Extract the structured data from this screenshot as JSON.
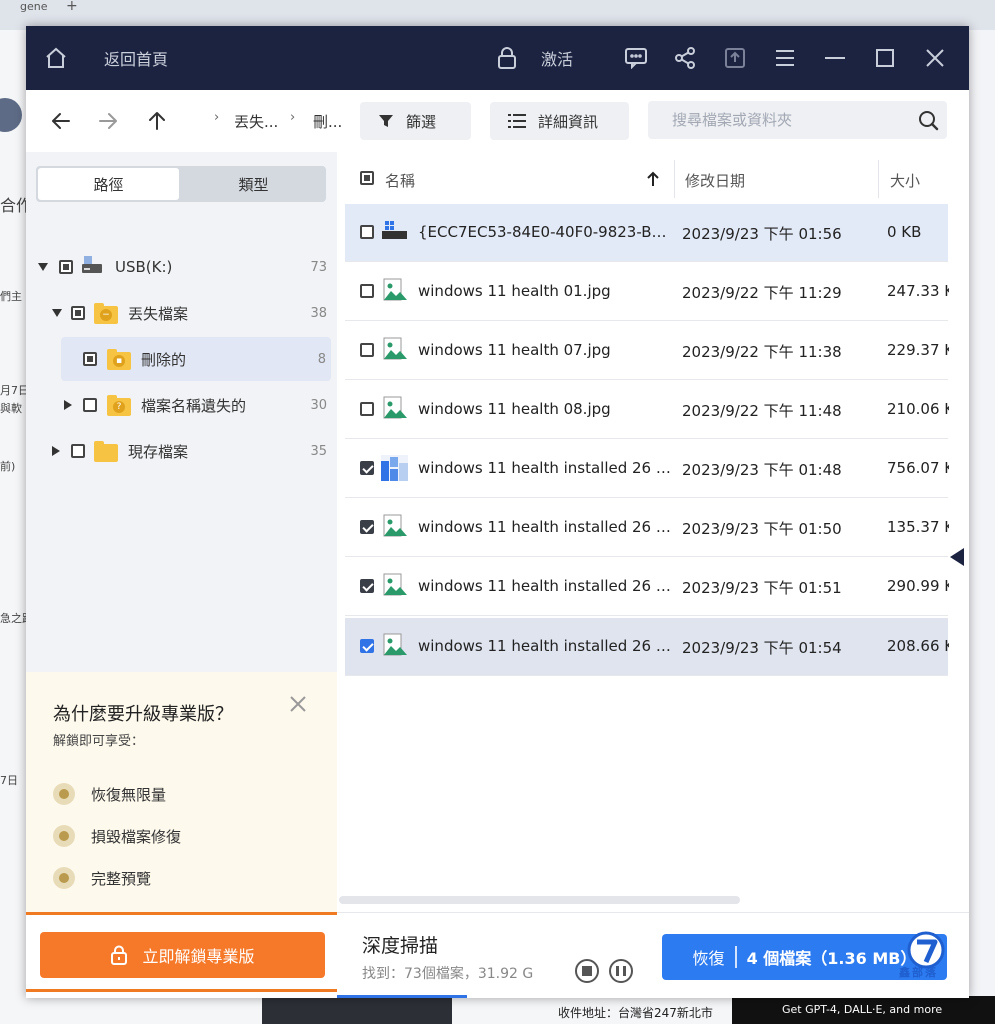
{
  "background": {
    "tab_fragment": "gene",
    "left_fragments": [
      "合作",
      "們主",
      "月7日",
      "與軟",
      "前)",
      "急之路",
      "7日 "
    ],
    "bottom_addr": "收件地址：台灣省247新北市",
    "bottom_ad": "Get GPT-4, DALL·E, and more"
  },
  "titlebar": {
    "home_label": "返回首頁",
    "activate_label": "激活"
  },
  "navbar": {
    "breadcrumb": [
      "丟失...",
      "刪..."
    ],
    "filter_label": "篩選",
    "details_label": "詳細資訊",
    "search_placeholder": "搜尋檔案或資料夾"
  },
  "sidebar": {
    "tab_path": "路徑",
    "tab_type": "類型",
    "tree": [
      {
        "label": "USB(K:)",
        "count": "73"
      },
      {
        "label": "丟失檔案",
        "count": "38"
      },
      {
        "label": "刪除的",
        "count": "8"
      },
      {
        "label": "檔案名稱遺失的",
        "count": "30"
      },
      {
        "label": "現存檔案",
        "count": "35"
      }
    ],
    "upgrade": {
      "title": "為什麼要升級專業版？",
      "subtitle": "解鎖即可享受：",
      "features": [
        "恢復無限量",
        "損毀檔案修復",
        "完整預覽"
      ]
    },
    "unlock_label": "立即解鎖專業版"
  },
  "list": {
    "headers": {
      "name": "名稱",
      "date": "修改日期",
      "size": "大小"
    },
    "rows": [
      {
        "name": "{ECC7EC53-84E0-40F0-9823-B6AF...",
        "date": "2023/9/23 下午 01:56",
        "size": "0 KB",
        "checked": false,
        "icon": "drive-file-icon"
      },
      {
        "name": "windows 11 health 01.jpg",
        "date": "2023/9/22 下午 11:29",
        "size": "247.33 K",
        "checked": false,
        "icon": "image-file-icon"
      },
      {
        "name": "windows 11 health 07.jpg",
        "date": "2023/9/22 下午 11:38",
        "size": "229.37 K",
        "checked": false,
        "icon": "image-file-icon"
      },
      {
        "name": "windows 11 health 08.jpg",
        "date": "2023/9/22 下午 11:48",
        "size": "210.06 K",
        "checked": false,
        "icon": "image-file-icon"
      },
      {
        "name": "windows 11 health installed 26 01...",
        "date": "2023/9/23 下午 01:48",
        "size": "756.07 K",
        "checked": true,
        "icon": "thumbnail-icon"
      },
      {
        "name": "windows 11 health installed 26 02...",
        "date": "2023/9/23 下午 01:50",
        "size": "135.37 K",
        "checked": true,
        "icon": "image-file-icon"
      },
      {
        "name": "windows 11 health installed 26 03...",
        "date": "2023/9/23 下午 01:51",
        "size": "290.99 K",
        "checked": true,
        "icon": "image-file-icon"
      },
      {
        "name": "windows 11 health installed 26 04...",
        "date": "2023/9/23 下午 01:54",
        "size": "208.66 K",
        "checked": true,
        "icon": "image-file-icon"
      }
    ]
  },
  "status": {
    "scan_label": "深度掃描",
    "found_text": "找到：73個檔案，31.92 G"
  },
  "recover": {
    "label": "恢復",
    "count": "4 個檔案",
    "size": "（1.36 MB）"
  },
  "watermark": "鑫部落",
  "colors": {
    "titlebar": "#1c2340",
    "accent_blue": "#2d7bf0",
    "accent_orange": "#f6792a",
    "selected_row": "#e3eaf7"
  }
}
